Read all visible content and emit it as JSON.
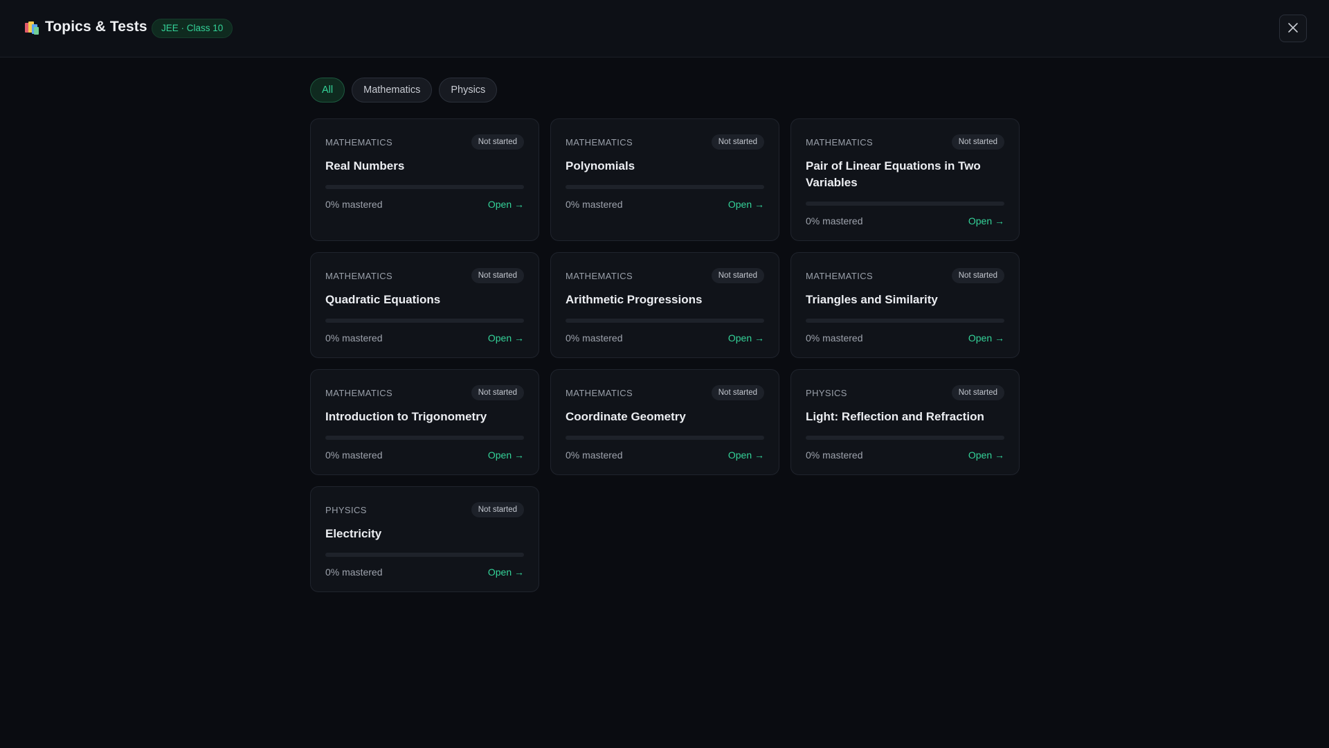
{
  "header": {
    "title": "Topics & Tests",
    "context_badge": "JEE · Class 10",
    "logo_icon": "books-icon",
    "close_icon": "close-icon"
  },
  "filters": [
    {
      "label": "All",
      "active": true
    },
    {
      "label": "Mathematics",
      "active": false
    },
    {
      "label": "Physics",
      "active": false
    }
  ],
  "cards": [
    {
      "subject": "MATHEMATICS",
      "status": "Not started",
      "title": "Real Numbers",
      "progress": 0,
      "mastered": "0% mastered",
      "open": "Open →"
    },
    {
      "subject": "MATHEMATICS",
      "status": "Not started",
      "title": "Polynomials",
      "progress": 0,
      "mastered": "0% mastered",
      "open": "Open →"
    },
    {
      "subject": "MATHEMATICS",
      "status": "Not started",
      "title": "Pair of Linear Equations in Two Variables",
      "progress": 0,
      "mastered": "0% mastered",
      "open": "Open →"
    },
    {
      "subject": "MATHEMATICS",
      "status": "Not started",
      "title": "Quadratic Equations",
      "progress": 0,
      "mastered": "0% mastered",
      "open": "Open →"
    },
    {
      "subject": "MATHEMATICS",
      "status": "Not started",
      "title": "Arithmetic Progressions",
      "progress": 0,
      "mastered": "0% mastered",
      "open": "Open →"
    },
    {
      "subject": "MATHEMATICS",
      "status": "Not started",
      "title": "Triangles and Similarity",
      "progress": 0,
      "mastered": "0% mastered",
      "open": "Open →"
    },
    {
      "subject": "MATHEMATICS",
      "status": "Not started",
      "title": "Introduction to Trigonometry",
      "progress": 0,
      "mastered": "0% mastered",
      "open": "Open →"
    },
    {
      "subject": "MATHEMATICS",
      "status": "Not started",
      "title": "Coordinate Geometry",
      "progress": 0,
      "mastered": "0% mastered",
      "open": "Open →"
    },
    {
      "subject": "PHYSICS",
      "status": "Not started",
      "title": "Light: Reflection and Refraction",
      "progress": 0,
      "mastered": "0% mastered",
      "open": "Open →"
    },
    {
      "subject": "PHYSICS",
      "status": "Not started",
      "title": "Electricity",
      "progress": 0,
      "mastered": "0% mastered",
      "open": "Open →"
    }
  ],
  "colors": {
    "accent": "#34d399",
    "background": "#0a0c11",
    "card": "#101319"
  }
}
